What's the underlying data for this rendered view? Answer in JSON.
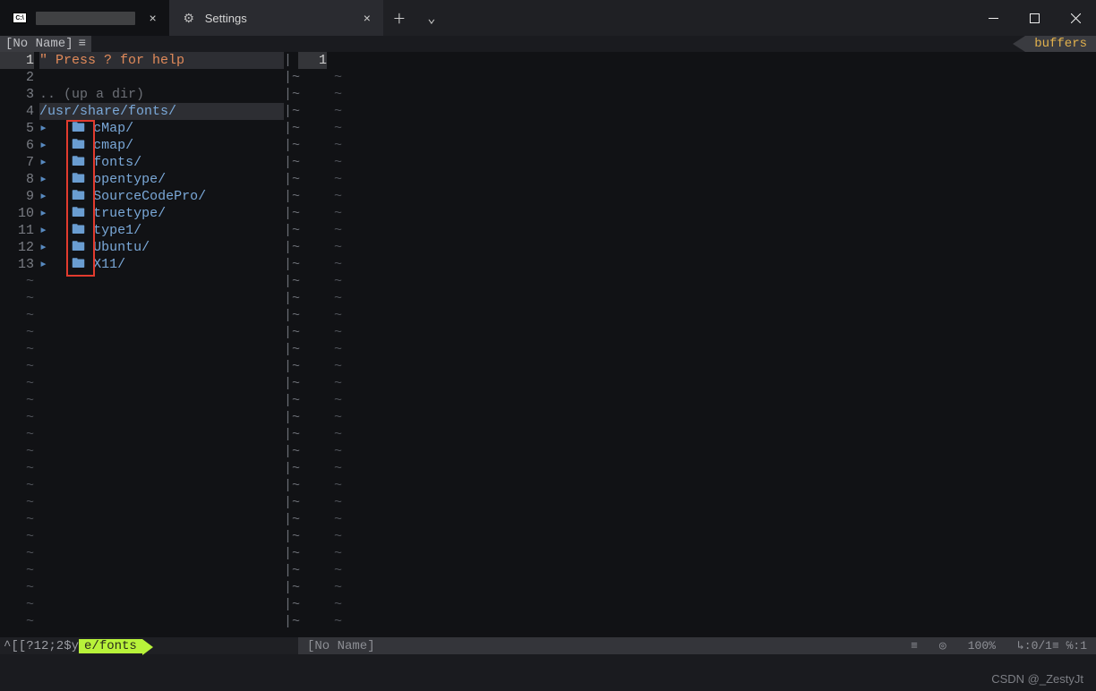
{
  "titlebar": {
    "tab1_label": "████████████",
    "tab2_label": "Settings",
    "close_glyph": "×",
    "add_glyph": "＋",
    "chevron_glyph": "⌄"
  },
  "header": {
    "left_tab": "[No Name]",
    "hamburger": "≡",
    "buffers": "buffers"
  },
  "left": {
    "lines": [
      "1",
      "2",
      "3",
      "4",
      "5",
      "6",
      "7",
      "8",
      "9",
      "10",
      "11",
      "12",
      "13"
    ],
    "row1": "\" Press ? for help",
    "row3": ".. (up a dir)",
    "row4": "/usr/share/fonts/",
    "items": [
      "cMap/",
      "cmap/",
      "fonts/",
      "opentype/",
      "SourceCodePro/",
      "truetype/",
      "type1/",
      "Ubuntu/",
      "X11/"
    ],
    "tilde": "~"
  },
  "right": {
    "line": "1"
  },
  "status": {
    "seq": "^[[?12;2$y",
    "efonts": "e/fonts",
    "rfile": "[No Name]",
    "icon1": "≡",
    "icon2": "◎",
    "pct": "100%",
    "pos": "↳:0/1≡ ℅:1"
  },
  "watermark": "CSDN @_ZestyJt"
}
